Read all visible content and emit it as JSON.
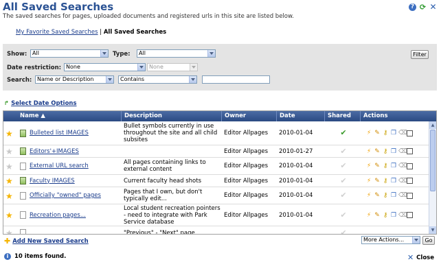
{
  "page": {
    "title": "All Saved Searches",
    "subtitle": "The saved searches for pages, uploaded documents and registered urls in this site are listed below."
  },
  "topicons": [
    "help-icon",
    "refresh-icon",
    "close-icon"
  ],
  "breadcrumb": {
    "link": "My Favorite Saved Searches",
    "sep": "|",
    "current": "All Saved Searches"
  },
  "filters": {
    "show_label": "Show:",
    "show_value": "All",
    "type_label": "Type:",
    "type_value": "All",
    "filter_button": "Filter",
    "date_label": "Date restriction:",
    "date_value": "None",
    "date_value2": "None",
    "search_label": "Search:",
    "search_field": "Name or Description",
    "search_op": "Contains",
    "search_text": ""
  },
  "date_options": "Select Date Options",
  "grid": {
    "columns": [
      "Name ▲",
      "Description",
      "Owner",
      "Date",
      "Shared",
      "Actions"
    ],
    "rows": [
      {
        "fav": true,
        "icon": "image",
        "name": "Bulleted list IMAGES",
        "desc": "Bullet symbols currently in use throughout the site and all child subsites",
        "owner": "Editor Allpages",
        "date": "2010-01-04",
        "shared": true
      },
      {
        "fav": false,
        "icon": "image",
        "name": "Editors'+IMAGES",
        "desc": "",
        "owner": "Editor Allpages",
        "date": "2010-01-27",
        "shared": false
      },
      {
        "fav": false,
        "icon": "doc",
        "name": "External URL search",
        "desc": "All pages containing links to external content",
        "owner": "Editor Allpages",
        "date": "2010-01-04",
        "shared": false
      },
      {
        "fav": true,
        "icon": "image",
        "name": "Faculty IMAGES",
        "desc": "Current faculty head shots",
        "owner": "Editor Allpages",
        "date": "2010-01-04",
        "shared": false
      },
      {
        "fav": true,
        "icon": "doc",
        "name": "Officially \"owned\" pages",
        "desc": "Pages that I own, but don't typically edit...",
        "owner": "Editor Allpages",
        "date": "2010-01-04",
        "shared": false
      },
      {
        "fav": true,
        "icon": "doc",
        "name": "Recreation pages...",
        "desc": "Local student recreation pointers - need to integrate with Park Service database",
        "owner": "Editor Allpages",
        "date": "2010-01-04",
        "shared": false
      },
      {
        "fav": false,
        "icon": "doc",
        "name": "",
        "desc": "\"Previous\" - \"Next\" page",
        "owner": "",
        "date": "",
        "shared": false
      }
    ]
  },
  "footer": {
    "add_new": "Add New Saved Search",
    "more_actions": "More Actions...",
    "go": "Go",
    "count": "10 items found.",
    "close": "Close"
  },
  "colors": {
    "title": "#2a5294",
    "header": "#2b4a83",
    "star_on": "#f5b400",
    "check": "#3a9a2a"
  }
}
